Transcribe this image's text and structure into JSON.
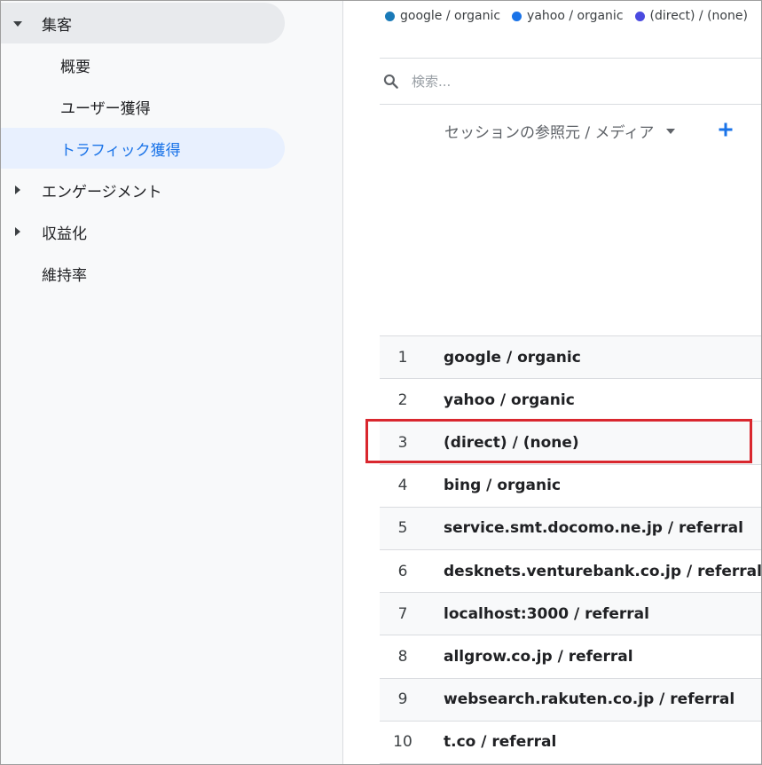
{
  "sidebar": {
    "items": [
      {
        "label": "集客",
        "caret": "down",
        "indent": 0,
        "state": "expanded"
      },
      {
        "label": "概要",
        "caret": "none",
        "indent": 1,
        "state": "normal"
      },
      {
        "label": "ユーザー獲得",
        "caret": "none",
        "indent": 1,
        "state": "normal"
      },
      {
        "label": "トラフィック獲得",
        "caret": "none",
        "indent": 1,
        "state": "active"
      },
      {
        "label": "エンゲージメント",
        "caret": "right",
        "indent": 0,
        "state": "collapsed"
      },
      {
        "label": "収益化",
        "caret": "right",
        "indent": 0,
        "state": "collapsed"
      },
      {
        "label": "維持率",
        "caret": "none",
        "indent": 0,
        "state": "normal"
      }
    ]
  },
  "legend": [
    {
      "label": "google / organic",
      "color": "#1a7ab8"
    },
    {
      "label": "yahoo / organic",
      "color": "#1a73e8"
    },
    {
      "label": "(direct) / (none)",
      "color": "#4a4ae0"
    }
  ],
  "search": {
    "placeholder": "検索..."
  },
  "table": {
    "dimension_header": "セッションの参照元 / メディア",
    "add_icon": "plus-icon",
    "rows": [
      {
        "num": "1",
        "label": "google / organic"
      },
      {
        "num": "2",
        "label": "yahoo / organic"
      },
      {
        "num": "3",
        "label": "(direct) / (none)"
      },
      {
        "num": "4",
        "label": "bing / organic"
      },
      {
        "num": "5",
        "label": "service.smt.docomo.ne.jp / referral"
      },
      {
        "num": "6",
        "label": "desknets.venturebank.co.jp / referral"
      },
      {
        "num": "7",
        "label": "localhost:3000 / referral"
      },
      {
        "num": "8",
        "label": "allgrow.co.jp / referral"
      },
      {
        "num": "9",
        "label": "websearch.rakuten.co.jp / referral"
      },
      {
        "num": "10",
        "label": "t.co / referral"
      }
    ]
  },
  "colors": {
    "accent": "#1a73e8",
    "highlight_box": "#d9272e"
  }
}
